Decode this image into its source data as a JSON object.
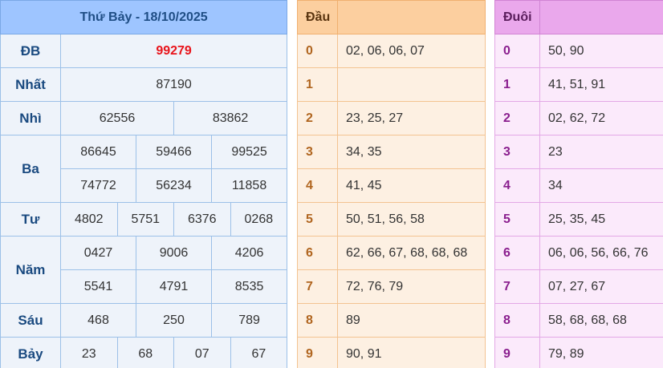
{
  "results": {
    "header": "Thứ Bảy - 18/10/2025",
    "rows": {
      "db": {
        "label": "ĐB",
        "values": [
          "99279"
        ]
      },
      "nhat": {
        "label": "Nhất",
        "values": [
          "87190"
        ]
      },
      "nhi": {
        "label": "Nhì",
        "values": [
          "62556",
          "83862"
        ]
      },
      "ba": {
        "label": "Ba",
        "values": [
          "86645",
          "59466",
          "99525",
          "74772",
          "56234",
          "11858"
        ]
      },
      "tu": {
        "label": "Tư",
        "values": [
          "4802",
          "5751",
          "6376",
          "0268"
        ]
      },
      "nam": {
        "label": "Năm",
        "values": [
          "0427",
          "9006",
          "4206",
          "5541",
          "4791",
          "8535"
        ]
      },
      "sau": {
        "label": "Sáu",
        "values": [
          "468",
          "250",
          "789"
        ]
      },
      "bay": {
        "label": "Bảy",
        "values": [
          "23",
          "68",
          "07",
          "67"
        ]
      }
    },
    "special_color": "#e8141b"
  },
  "dau": {
    "header": "Đầu",
    "rows": [
      {
        "idx": "0",
        "val": "02, 06, 06, 07"
      },
      {
        "idx": "1",
        "val": ""
      },
      {
        "idx": "2",
        "val": "23, 25, 27"
      },
      {
        "idx": "3",
        "val": "34, 35"
      },
      {
        "idx": "4",
        "val": "41, 45"
      },
      {
        "idx": "5",
        "val": "50, 51, 56, 58"
      },
      {
        "idx": "6",
        "val": "62, 66, 67, 68, 68, 68"
      },
      {
        "idx": "7",
        "val": "72, 76, 79"
      },
      {
        "idx": "8",
        "val": "89"
      },
      {
        "idx": "9",
        "val": "90, 91"
      }
    ]
  },
  "duoi": {
    "header": "Đuôi",
    "rows": [
      {
        "idx": "0",
        "val": "50, 90"
      },
      {
        "idx": "1",
        "val": "41, 51, 91"
      },
      {
        "idx": "2",
        "val": "02, 62, 72"
      },
      {
        "idx": "3",
        "val": "23"
      },
      {
        "idx": "4",
        "val": "34"
      },
      {
        "idx": "5",
        "val": "25, 35, 45"
      },
      {
        "idx": "6",
        "val": "06, 06, 56, 66, 76"
      },
      {
        "idx": "7",
        "val": "07, 27, 67"
      },
      {
        "idx": "8",
        "val": "58, 68, 68, 68"
      },
      {
        "idx": "9",
        "val": "79, 89"
      }
    ]
  }
}
